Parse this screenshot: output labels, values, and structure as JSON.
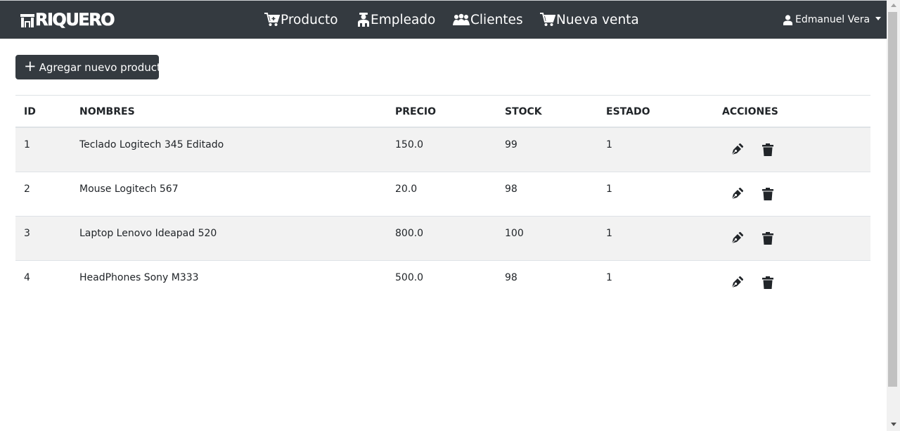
{
  "navbar": {
    "brand_text": "RIQUERO",
    "links": [
      {
        "label": "Producto",
        "icon": "cart-plus-icon"
      },
      {
        "label": "Empleado",
        "icon": "employee-icon"
      },
      {
        "label": "Clientes",
        "icon": "clients-icon"
      },
      {
        "label": "Nueva venta",
        "icon": "cart-icon"
      }
    ],
    "user": {
      "name": "Edmanuel Vera",
      "icon": "user-icon"
    }
  },
  "toolbar": {
    "add_label": "Agregar nuevo producto"
  },
  "table": {
    "headers": [
      "ID",
      "NOMBRES",
      "PRECIO",
      "STOCK",
      "ESTADO",
      "ACCIONES"
    ],
    "rows": [
      {
        "id": "1",
        "nombre": "Teclado Logitech 345 Editado",
        "precio": "150.0",
        "stock": "99",
        "estado": "1"
      },
      {
        "id": "2",
        "nombre": "Mouse Logitech 567",
        "precio": "20.0",
        "stock": "98",
        "estado": "1"
      },
      {
        "id": "3",
        "nombre": "Laptop Lenovo Ideapad 520",
        "precio": "800.0",
        "stock": "100",
        "estado": "1"
      },
      {
        "id": "4",
        "nombre": "HeadPhones Sony M333",
        "precio": "500.0",
        "stock": "98",
        "estado": "1"
      }
    ],
    "action_icons": [
      "edit-pen-icon",
      "trash-icon"
    ]
  },
  "colors": {
    "navbar": "#343a40",
    "stripe": "#f2f2f2",
    "border": "#dee2e6"
  }
}
